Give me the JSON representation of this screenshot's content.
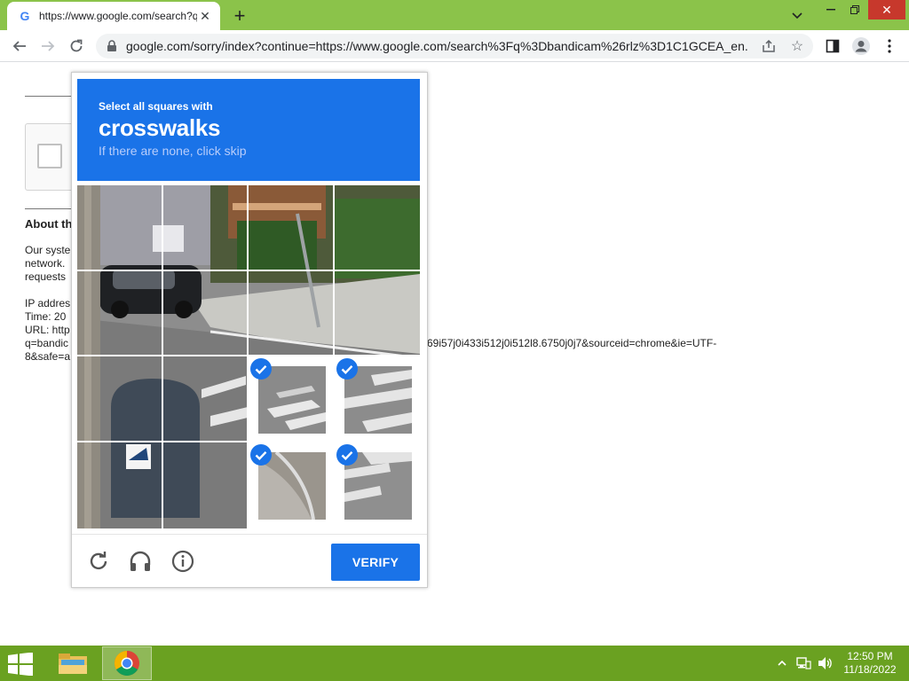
{
  "browser": {
    "tab_title": "https://www.google.com/search?q",
    "tab_favicon": "G",
    "url": "google.com/sorry/index?continue=https://www.google.com/search%3Fq%3Dbandicam%26rlz%3D1C1GCEA_en..."
  },
  "page": {
    "about_heading": "About th",
    "body_lines": [
      "Our syste",
      "network.",
      "requests"
    ],
    "ip_line": "IP addres",
    "time_line": "Time: 20",
    "url_line_1": "URL: http",
    "url_line_2": "q=bandic",
    "url_line_3": "8&safe=a",
    "url_continuation": "69i57j0i433i512j0i512l8.6750j0j7&sourceid=chrome&ie=UTF-",
    "url_continuation_2": "8"
  },
  "captcha": {
    "instruction": "Select all squares with",
    "target": "crosswalks",
    "hint": "If there are none, click skip",
    "verify_label": "VERIFY",
    "grid_size": 4,
    "selected_tiles": [
      [
        2,
        2
      ],
      [
        2,
        3
      ],
      [
        3,
        2
      ],
      [
        3,
        3
      ]
    ]
  },
  "taskbar": {
    "time": "12:50 PM",
    "date": "11/18/2022"
  }
}
